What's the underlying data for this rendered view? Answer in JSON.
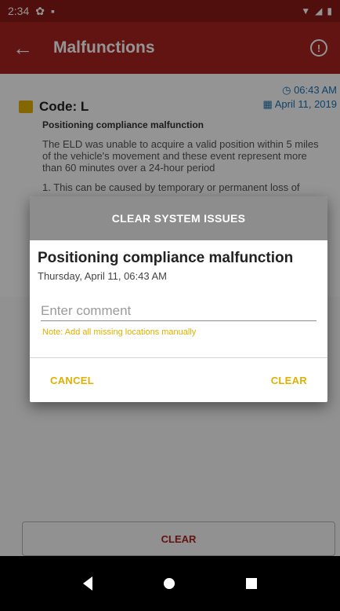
{
  "status_bar": {
    "time": "2:34"
  },
  "app_bar": {
    "title": "Malfunctions"
  },
  "malfunction": {
    "time": "06:43 AM",
    "date": "April 11, 2019",
    "code_label": "Code: L",
    "subtitle": "Positioning compliance malfunction",
    "description": "The ELD was unable to acquire a valid position within 5 miles of the vehicle's movement and these event represent more than 60 minutes over a 24-hour period",
    "cause": "1. This can be caused by temporary or permanent loss of"
  },
  "dialog": {
    "header": "CLEAR SYSTEM ISSUES",
    "title": "Positioning compliance malfunction",
    "date": "Thursday, April 11, 06:43 AM",
    "comment_placeholder": "Enter comment",
    "comment_value": "",
    "note": "Note: Add all missing locations manually",
    "cancel_label": "CANCEL",
    "clear_label": "CLEAR"
  },
  "bottom_button": {
    "label": "CLEAR"
  },
  "colors": {
    "status_bar": "#8a1b17",
    "app_bar": "#a8241e",
    "accent": "#e0b000",
    "date_blue": "#1b73b5",
    "dialog_header": "#8d8d8d"
  },
  "icons": {
    "status_left": [
      "settings-icon",
      "lock-icon"
    ],
    "status_right": [
      "wifi-icon",
      "signal-icon",
      "battery-icon"
    ],
    "app_bar": [
      "back-arrow-icon",
      "info-icon"
    ],
    "meta": [
      "clock-icon",
      "calendar-icon"
    ],
    "nav": [
      "nav-back-icon",
      "nav-home-icon",
      "nav-recents-icon"
    ]
  }
}
